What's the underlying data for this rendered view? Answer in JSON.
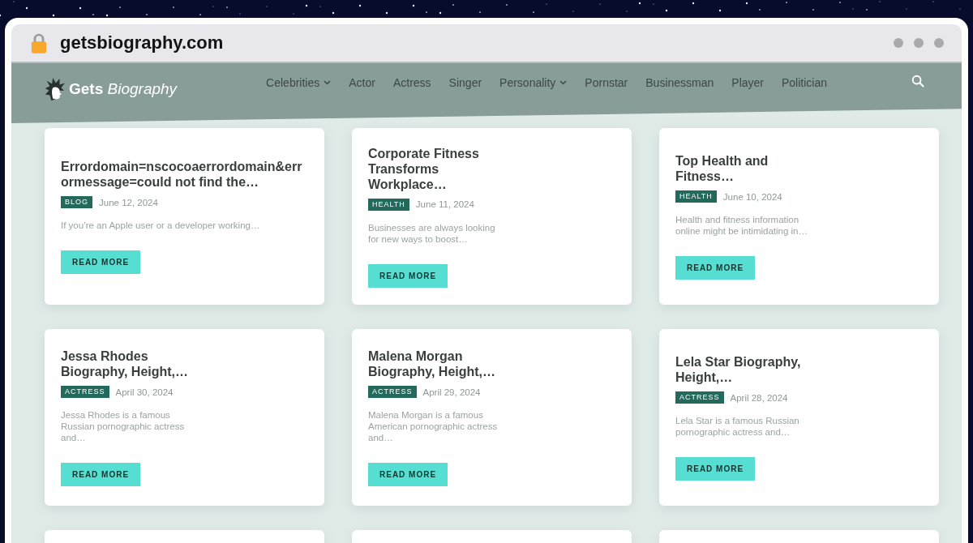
{
  "browser": {
    "url": "getsbiography.com"
  },
  "site_header": {
    "logo": "**Gets** *Biography*",
    "nav": [
      {
        "label": "Celebrities",
        "has_submenu": true
      },
      {
        "label": "Actor",
        "has_submenu": false
      },
      {
        "label": "Actress",
        "has_submenu": false
      },
      {
        "label": "Singer",
        "has_submenu": false
      },
      {
        "label": "Personality",
        "has_submenu": true
      },
      {
        "label": "Pornstar",
        "has_submenu": false
      },
      {
        "label": "Businessman",
        "has_submenu": false
      },
      {
        "label": "Player",
        "has_submenu": false
      },
      {
        "label": "Politician",
        "has_submenu": false
      }
    ]
  },
  "posts": [
    {
      "kind": "post",
      "title": "Errordomain=nscocoaerrordomain&errormessage=could not find the…",
      "category": "BLOG",
      "date": "June 12, 2024",
      "excerpt": "If you’re an Apple user or a developer working…",
      "button": "READ MORE"
    },
    {
      "kind": "post",
      "title": "Corporate Fitness Transforms Workplace…",
      "category": "HEALTH",
      "date": "June 11, 2024",
      "excerpt": "Businesses are always looking for new ways to boost…",
      "button": "READ MORE"
    },
    {
      "kind": "post",
      "title": "Top Health and Fitness…",
      "category": "HEALTH",
      "date": "June 10, 2024",
      "excerpt": "Health and fitness information online might be intimidating in…",
      "button": "READ MORE"
    },
    {
      "kind": "post",
      "title": "Jessa Rhodes Biography, Height,…",
      "category": "ACTRESS",
      "date": "April 30, 2024",
      "excerpt": "Jessa Rhodes is a famous Russian pornographic actress and…",
      "button": "READ MORE"
    },
    {
      "kind": "post",
      "title": "Malena Morgan Biography, Height,…",
      "category": "ACTRESS",
      "date": "April 29, 2024",
      "excerpt": "Malena Morgan is a famous American pornographic actress and…",
      "button": "READ MORE"
    },
    {
      "kind": "post",
      "title": "Lela Star Biography, Height,…",
      "category": "ACTRESS",
      "date": "April 28, 2024",
      "excerpt": "Lela Star is a famous Russian pornographic actress and…",
      "button": "READ MORE"
    },
    {
      "kind": "partial"
    },
    {
      "kind": "partial"
    },
    {
      "kind": "partial"
    }
  ]
}
